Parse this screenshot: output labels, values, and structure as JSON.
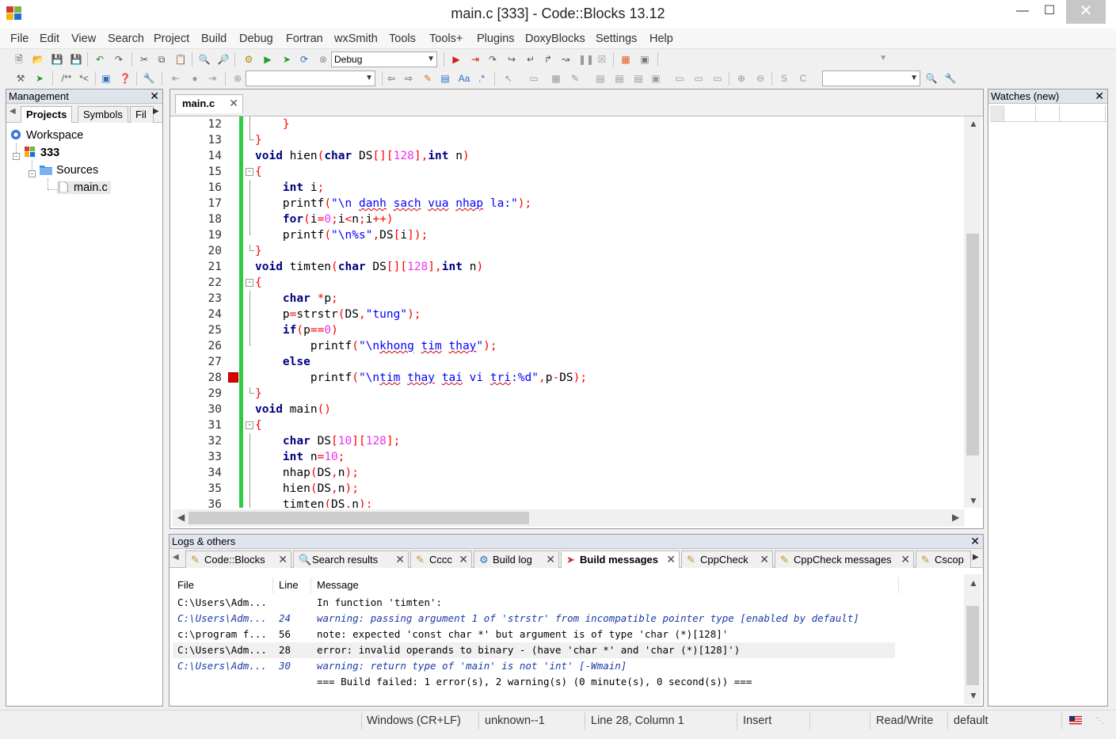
{
  "window": {
    "title": "main.c [333] - Code::Blocks 13.12"
  },
  "menu": [
    "File",
    "Edit",
    "View",
    "Search",
    "Project",
    "Build",
    "Debug",
    "Fortran",
    "wxSmith",
    "Tools",
    "Tools+",
    "Plugins",
    "DoxyBlocks",
    "Settings",
    "Help"
  ],
  "toolbar": {
    "build_target": "Debug",
    "doxy_comment": "/**",
    "doxy_line": "*<"
  },
  "management": {
    "title": "Management",
    "tabs": [
      "Projects",
      "Symbols",
      "Fil"
    ],
    "tree": {
      "workspace": "Workspace",
      "project": "333",
      "folder": "Sources",
      "file": "main.c"
    }
  },
  "editor": {
    "tab_label": "main.c",
    "breakpoint_line": 28,
    "lines": [
      {
        "n": "12",
        "html": "    <span class='op'>}</span>"
      },
      {
        "n": "13",
        "html": "<span class='op'>}</span>"
      },
      {
        "n": "14",
        "html": "<span class='kw'>void</span> hien<span class='op'>(</span><span class='kw'>char</span> DS<span class='op'>[][</span><span class='num'>128</span><span class='op'>],</span><span class='kw'>int</span> n<span class='op'>)</span>"
      },
      {
        "n": "15",
        "html": "<span class='op'>{</span>"
      },
      {
        "n": "16",
        "html": "    <span class='kw'>int</span> i<span class='op'>;</span>"
      },
      {
        "n": "17",
        "html": "    printf<span class='op'>(</span><span class='str'>\"\\n <span class='sq'>danh</span> <span class='sq'>sach</span> <span class='sq'>vua</span> <span class='sq'>nhap</span> la:\"</span><span class='op'>);</span>"
      },
      {
        "n": "18",
        "html": "    <span class='kw'>for</span><span class='op'>(</span>i<span class='op'>=</span><span class='num'>0</span><span class='op'>;</span>i<span class='op'>&lt;</span>n<span class='op'>;</span>i<span class='op'>++)</span>"
      },
      {
        "n": "19",
        "html": "    printf<span class='op'>(</span><span class='str'>\"\\n%s\"</span><span class='op'>,</span>DS<span class='op'>[</span>i<span class='op'>]);</span>"
      },
      {
        "n": "20",
        "html": "<span class='op'>}</span>"
      },
      {
        "n": "21",
        "html": "<span class='kw'>void</span> timten<span class='op'>(</span><span class='kw'>char</span> DS<span class='op'>[][</span><span class='num'>128</span><span class='op'>],</span><span class='kw'>int</span> n<span class='op'>)</span>"
      },
      {
        "n": "22",
        "html": "<span class='op'>{</span>"
      },
      {
        "n": "23",
        "html": "    <span class='kw'>char</span> <span class='op'>*</span>p<span class='op'>;</span>"
      },
      {
        "n": "24",
        "html": "    p<span class='op'>=</span>strstr<span class='op'>(</span>DS<span class='op'>,</span><span class='str'>\"tung\"</span><span class='op'>);</span>"
      },
      {
        "n": "25",
        "html": "    <span class='kw'>if</span><span class='op'>(</span>p<span class='op'>==</span><span class='num'>0</span><span class='op'>)</span>"
      },
      {
        "n": "26",
        "html": "        printf<span class='op'>(</span><span class='str'>\"\\n<span class='sq'>khong</span> <span class='sq'>tim</span> <span class='sq'>thay</span>\"</span><span class='op'>);</span>"
      },
      {
        "n": "27",
        "html": "    <span class='kw'>else</span>"
      },
      {
        "n": "28",
        "html": "        printf<span class='op'>(</span><span class='str'>\"\\n<span class='sq'>tim</span> <span class='sq'>thay</span> <span class='sq'>tai</span> vi <span class='sq'>tri</span>:%d\"</span><span class='op'>,</span>p<span class='op'>-</span>DS<span class='op'>);</span>"
      },
      {
        "n": "29",
        "html": "<span class='op'>}</span>"
      },
      {
        "n": "30",
        "html": "<span class='kw'>void</span> main<span class='op'>()</span>"
      },
      {
        "n": "31",
        "html": "<span class='op'>{</span>"
      },
      {
        "n": "32",
        "html": "    <span class='kw'>char</span> DS<span class='op'>[</span><span class='num'>10</span><span class='op'>][</span><span class='num'>128</span><span class='op'>];</span>"
      },
      {
        "n": "33",
        "html": "    <span class='kw'>int</span> n<span class='op'>=</span><span class='num'>10</span><span class='op'>;</span>"
      },
      {
        "n": "34",
        "html": "    nhap<span class='op'>(</span>DS<span class='op'>,</span>n<span class='op'>);</span>"
      },
      {
        "n": "35",
        "html": "    hien<span class='op'>(</span>DS<span class='op'>,</span>n<span class='op'>);</span>"
      },
      {
        "n": "36",
        "html": "    timten<span class='op'>(</span>DS<span class='op'>,</span>n<span class='op'>);</span>"
      }
    ]
  },
  "watches": {
    "title": "Watches (new)"
  },
  "logs": {
    "title": "Logs & others",
    "tabs": [
      "Code::Blocks",
      "Search results",
      "Cccc",
      "Build log",
      "Build messages",
      "CppCheck",
      "CppCheck messages",
      "Cscop"
    ],
    "active_tab": "Build messages",
    "columns": [
      "File",
      "Line",
      "Message"
    ],
    "rows": [
      {
        "file": "C:\\Users\\Adm...",
        "line": "",
        "msg": "In function 'timten':",
        "kind": "normal"
      },
      {
        "file": "C:\\Users\\Adm...",
        "line": "24",
        "msg": "warning: passing argument 1 of 'strstr' from incompatible pointer type [enabled by default]",
        "kind": "warn"
      },
      {
        "file": "c:\\program f...",
        "line": "56",
        "msg": "note: expected 'const char *' but argument is of type 'char (*)[128]'",
        "kind": "normal"
      },
      {
        "file": "C:\\Users\\Adm...",
        "line": "28",
        "msg": "error: invalid operands to binary - (have 'char *' and 'char (*)[128]')",
        "kind": "sel"
      },
      {
        "file": "C:\\Users\\Adm...",
        "line": "30",
        "msg": "warning: return type of 'main' is not 'int' [-Wmain]",
        "kind": "warn"
      },
      {
        "file": "",
        "line": "",
        "msg": "=== Build failed: 1 error(s), 2 warning(s) (0 minute(s), 0 second(s)) ===",
        "kind": "normal"
      }
    ]
  },
  "status": {
    "eol": "Windows (CR+LF)",
    "encoding": "unknown--1",
    "position": "Line 28, Column 1",
    "mode": "Insert",
    "access": "Read/Write",
    "profile": "default"
  }
}
